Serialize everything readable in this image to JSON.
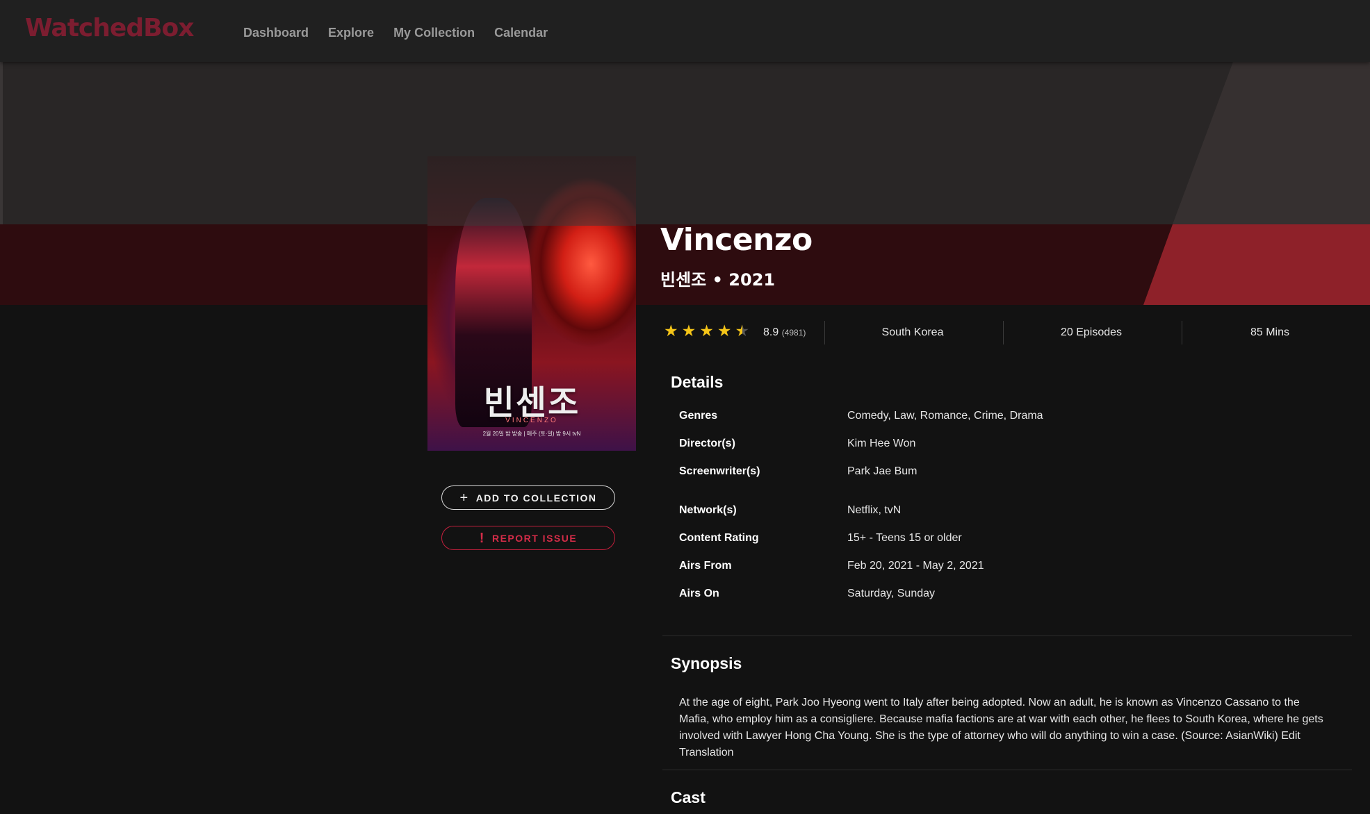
{
  "app": {
    "logo": "WatchedBox",
    "nav": [
      "Dashboard",
      "Explore",
      "My Collection",
      "Calendar"
    ]
  },
  "poster": {
    "title_kr": "빈센조",
    "title_en": "VINCENZO",
    "date_line": "2월 20일 밤 방송 | 매주 (토·일) 밤 9시 tvN"
  },
  "actions": {
    "add_label": "ADD TO COLLECTION",
    "add_icon": "plus-icon",
    "report_label": "REPORT ISSUE",
    "report_icon": "exclamation-icon"
  },
  "show": {
    "title": "Vincenzo",
    "subtitle": "빈센조 • 2021"
  },
  "stats": {
    "stars": 4.5,
    "rating": "8.9",
    "rating_count": "(4981)",
    "country": "South Korea",
    "episodes": "20 Episodes",
    "duration": "85 Mins"
  },
  "details": {
    "heading": "Details",
    "rows": [
      {
        "label": "Genres",
        "value": "Comedy, Law, Romance, Crime, Drama"
      },
      {
        "label": "Director(s)",
        "value": "Kim Hee Won"
      },
      {
        "label": "Screenwriter(s)",
        "value": "Park Jae Bum"
      },
      {
        "label": "Network(s)",
        "value": "Netflix, tvN"
      },
      {
        "label": "Content Rating",
        "value": "15+ - Teens 15 or older"
      },
      {
        "label": "Airs From",
        "value": "Feb 20, 2021 - May 2, 2021"
      },
      {
        "label": "Airs On",
        "value": "Saturday, Sunday"
      }
    ]
  },
  "synopsis": {
    "heading": "Synopsis",
    "text": "At the age of eight, Park Joo Hyeong went to Italy after being adopted. Now an adult, he is known as Vincenzo Cassano to the Mafia, who employ him as a consigliere. Because mafia factions are at war with each other, he flees to South Korea, where he gets involved with Lawyer Hong Cha Young. She is the type of attorney who will do anything to win a case. (Source: AsianWiki) Edit Translation"
  },
  "cast": {
    "heading": "Cast"
  },
  "colors": {
    "accent": "#c4203d",
    "logo": "#7c1d30",
    "star": "#f5c518",
    "background": "#121212"
  }
}
